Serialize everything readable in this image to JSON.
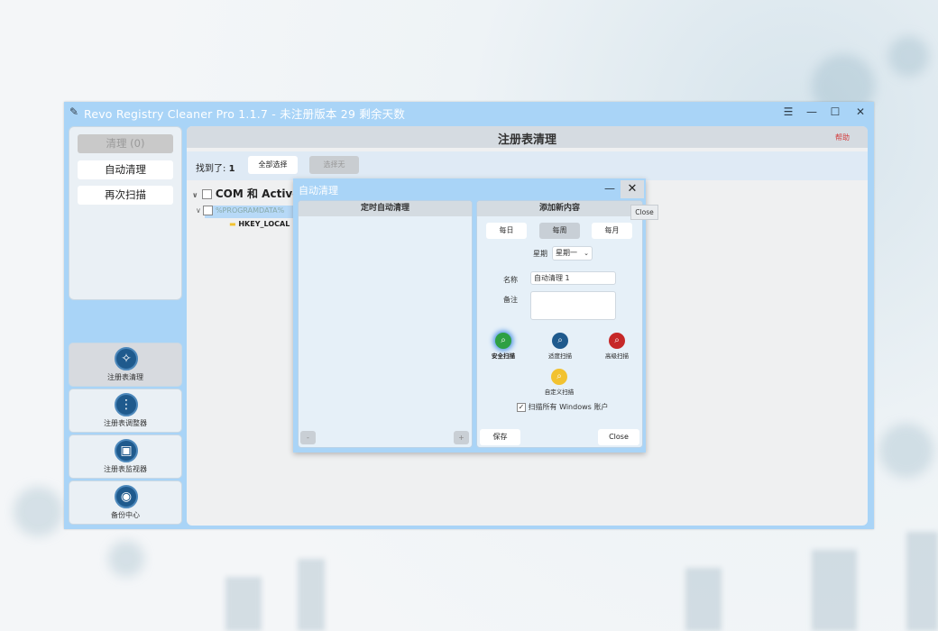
{
  "window": {
    "title": "Revo Registry Cleaner Pro 1.1.7 - 未注册版本 29 剩余天数",
    "controls": {
      "menu_icon": "hamburger-icon",
      "minimize": "—",
      "maximize": "☐",
      "close": "✕"
    }
  },
  "sidebar": {
    "clean_button": "清理 (0)",
    "auto_clean_button": "自动清理",
    "rescan_button": "再次扫描",
    "nav": [
      {
        "label": "注册表清理",
        "icon": "broom-icon",
        "active": true
      },
      {
        "label": "注册表调整器",
        "icon": "sliders-icon",
        "active": false
      },
      {
        "label": "注册表监视器",
        "icon": "monitor-icon",
        "active": false
      },
      {
        "label": "备份中心",
        "icon": "backup-icon",
        "active": false
      }
    ]
  },
  "main": {
    "title": "注册表清理",
    "help_link": "帮助",
    "found_label": "找到了:",
    "found_count": "1",
    "select_all_button": "全部选择",
    "disabled_button": "选择无",
    "tree": {
      "group": "COM 和 ActiveX",
      "item": "%PROGRAMDATA%",
      "key": "HKEY_LOCAL"
    }
  },
  "dialog": {
    "title": "自动清理",
    "minimize": "—",
    "close": "✕",
    "tooltip": "Close",
    "left_panel": {
      "header": "定时自动清理",
      "remove_button": "-",
      "add_button": "+"
    },
    "right_panel": {
      "header": "添加新内容",
      "frequency": [
        "每日",
        "每周",
        "每月"
      ],
      "selected_frequency": "每周",
      "weekday_label": "星期",
      "weekday_value": "星期一",
      "name_label": "名称",
      "name_value": "自动清理 1",
      "note_label": "备注",
      "scan_modes": [
        {
          "label": "安全扫描",
          "icon": "safe-scan-icon",
          "color": "#2ea043",
          "selected": true
        },
        {
          "label": "适度扫描",
          "icon": "moderate-scan-icon",
          "color": "#1f5a8d",
          "selected": false
        },
        {
          "label": "高级扫描",
          "icon": "advanced-scan-icon",
          "color": "#c62828",
          "selected": false
        },
        {
          "label": "自定义扫描",
          "icon": "custom-scan-icon",
          "color": "#f2c230",
          "selected": false
        }
      ],
      "scan_all_accounts_label": "扫描所有 Windows 账户",
      "scan_all_accounts_checked": true,
      "save_button": "保存",
      "close_button": "Close"
    }
  },
  "colors": {
    "window_frame": "#a9d4f7",
    "panel_bg": "#e6f0f8",
    "header_bg": "#d4dbe1",
    "help_red": "#d23b3b"
  }
}
